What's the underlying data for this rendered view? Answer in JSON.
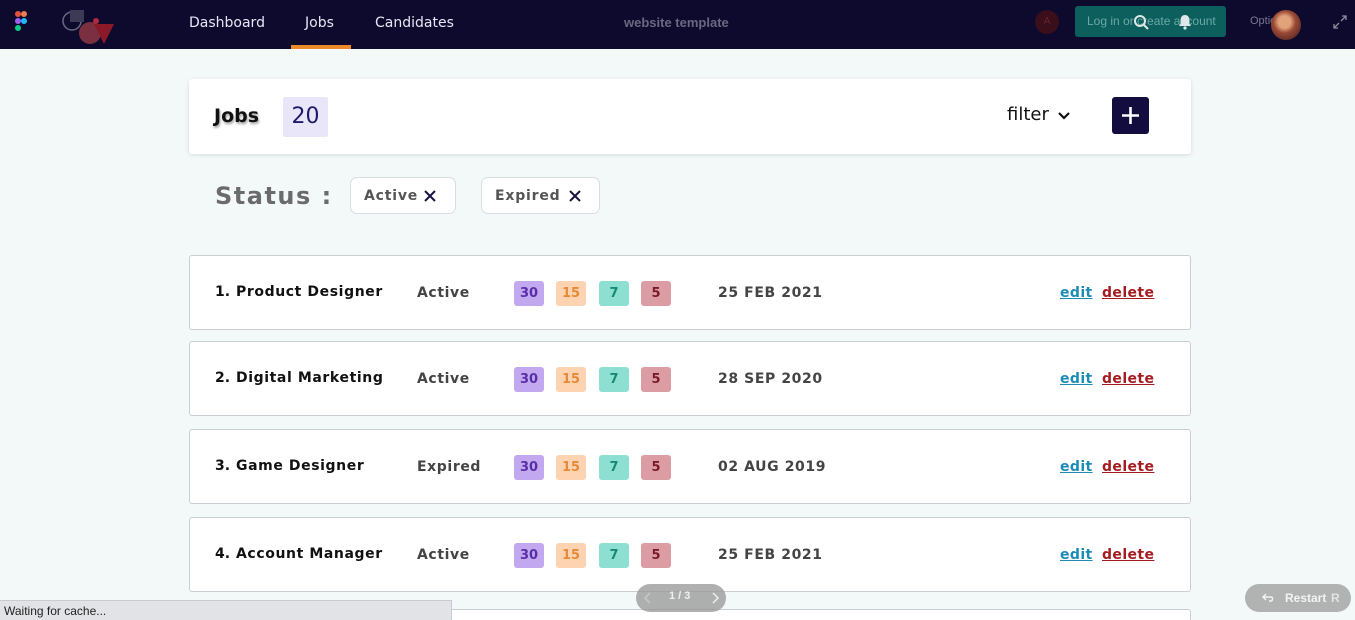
{
  "nav": {
    "links": [
      "Dashboard",
      "Jobs",
      "Candidates"
    ],
    "site_title": "website template",
    "avatar_initial": "A",
    "login_label": "Log in or create account",
    "options_label": "Options"
  },
  "jobs_header": {
    "title": "Jobs",
    "count": "20",
    "filter_label": "filter"
  },
  "status_filter": {
    "label": "Status :",
    "chips": [
      "Active",
      "Expired"
    ]
  },
  "jobs": [
    {
      "number": "1.",
      "title": "Product Designer",
      "status": "Active",
      "counts": [
        "30",
        "15",
        "7",
        "5"
      ],
      "date": "25 FEB 2021"
    },
    {
      "number": "2.",
      "title": "Digital Marketing",
      "status": "Active",
      "counts": [
        "30",
        "15",
        "7",
        "5"
      ],
      "date": "28 SEP 2020"
    },
    {
      "number": "3.",
      "title": "Game Designer",
      "status": "Expired",
      "counts": [
        "30",
        "15",
        "7",
        "5"
      ],
      "date": "02 AUG 2019"
    },
    {
      "number": "4.",
      "title": "Account Manager",
      "status": "Active",
      "counts": [
        "30",
        "15",
        "7",
        "5"
      ],
      "date": "25 FEB 2021"
    }
  ],
  "row_actions": {
    "edit": "edit",
    "delete": "delete"
  },
  "pager": {
    "text": "1 / 3"
  },
  "restart": {
    "label": "Restart",
    "key": "R"
  },
  "status_bar": {
    "text": "Waiting for cache..."
  },
  "colors": {
    "topbar_bg": "#0d0a2e",
    "accent_orange": "#ec8a2a",
    "add_button": "#120c3f",
    "badge_purple": "#c2a8ee",
    "badge_peach": "#fdd3b2",
    "badge_teal": "#8de0d1",
    "badge_rose": "#dc9ca4",
    "edit_link": "#1d8cb5",
    "delete_link": "#a51c20"
  },
  "icons": [
    "figma-icon",
    "brand-logo",
    "search-icon",
    "bell-icon",
    "chevron-down-icon",
    "expand-icon",
    "plus-icon",
    "close-icon",
    "chevron-left-icon",
    "chevron-right-icon",
    "undo-icon"
  ]
}
